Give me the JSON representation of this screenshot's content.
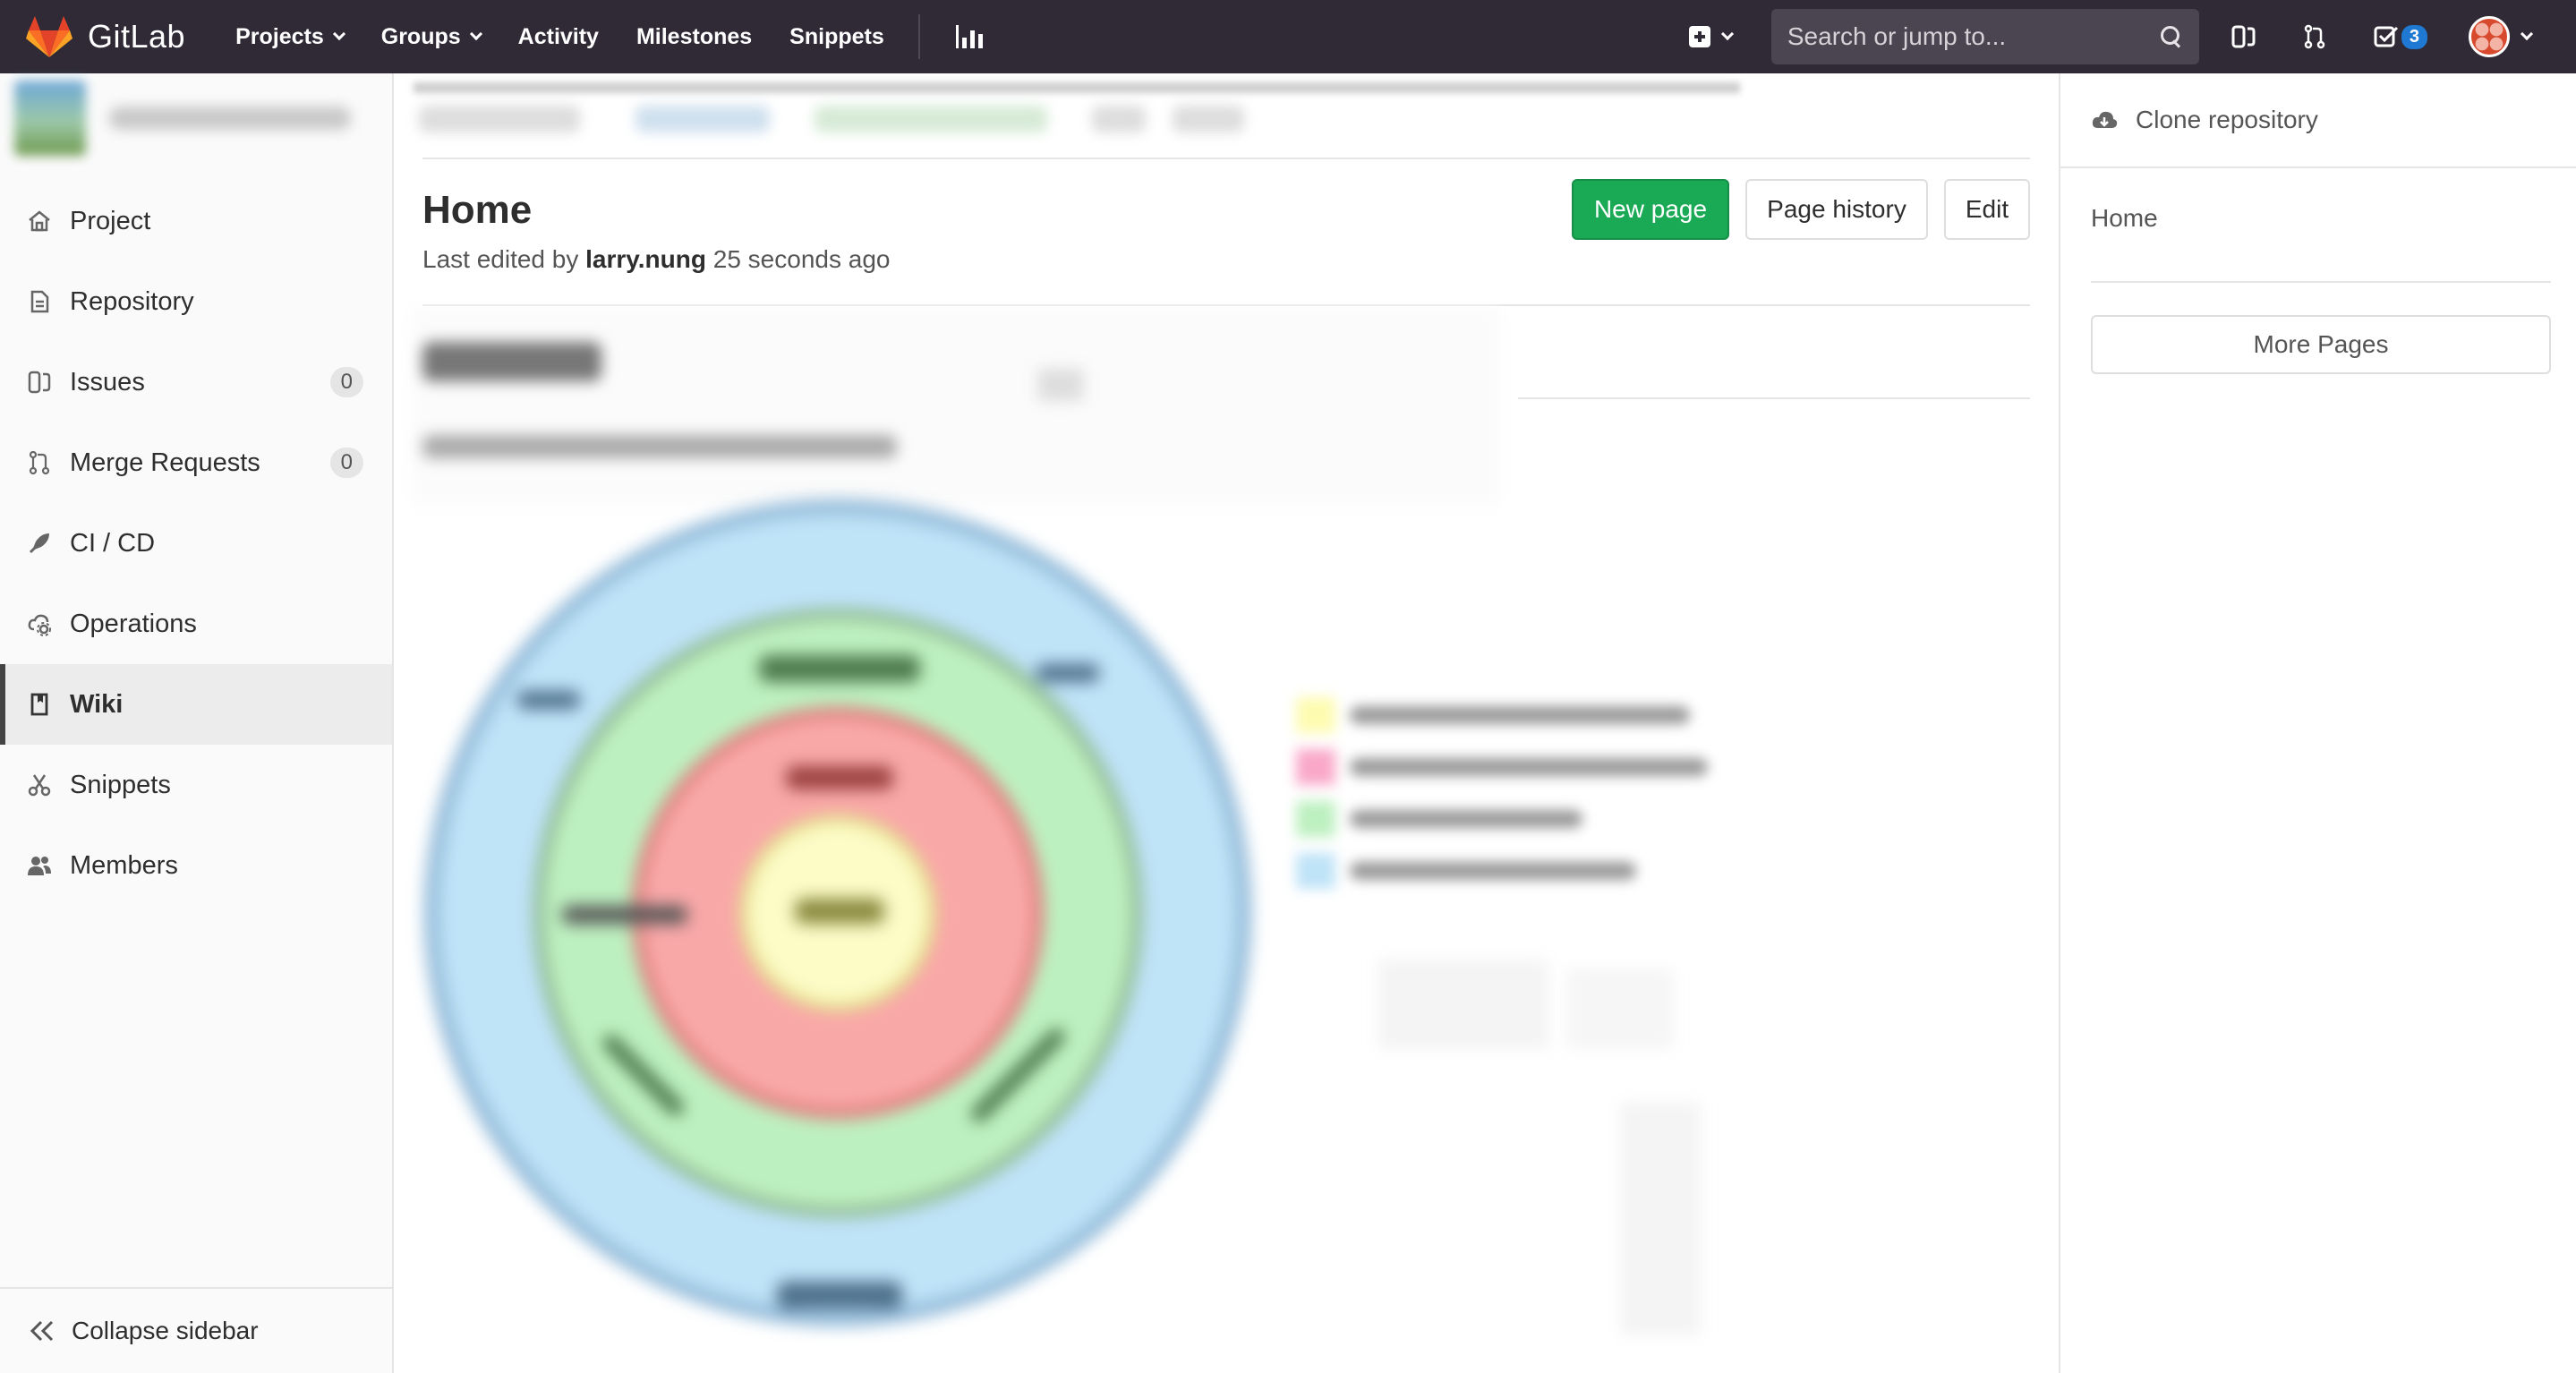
{
  "navbar": {
    "brand": "GitLab",
    "links": [
      {
        "label": "Projects",
        "dropdown": true
      },
      {
        "label": "Groups",
        "dropdown": true
      },
      {
        "label": "Activity",
        "dropdown": false
      },
      {
        "label": "Milestones",
        "dropdown": false
      },
      {
        "label": "Snippets",
        "dropdown": false
      }
    ],
    "search_placeholder": "Search or jump to...",
    "todo_count": "3",
    "colors": {
      "background": "#2f2a36",
      "badge": "#1f78d1"
    }
  },
  "sidebar": {
    "items": [
      {
        "label": "Project",
        "icon": "home-icon"
      },
      {
        "label": "Repository",
        "icon": "file-icon"
      },
      {
        "label": "Issues",
        "icon": "issues-icon",
        "count": "0"
      },
      {
        "label": "Merge Requests",
        "icon": "merge-request-icon",
        "count": "0"
      },
      {
        "label": "CI / CD",
        "icon": "rocket-icon"
      },
      {
        "label": "Operations",
        "icon": "cloud-gear-icon"
      },
      {
        "label": "Wiki",
        "icon": "book-icon",
        "active": true
      },
      {
        "label": "Snippets",
        "icon": "scissors-icon"
      },
      {
        "label": "Members",
        "icon": "users-icon"
      }
    ],
    "collapse_label": "Collapse sidebar"
  },
  "wiki": {
    "title": "Home",
    "last_edited_prefix": "Last edited by",
    "author": "larry.nung",
    "time_ago": "25 seconds ago",
    "buttons": {
      "new_page": "New page",
      "page_history": "Page history",
      "edit": "Edit"
    },
    "colors": {
      "new_page_button": "#1aaa55"
    }
  },
  "right_sidebar": {
    "clone_label": "Clone repository",
    "pages": [
      "Home"
    ],
    "more_pages_label": "More Pages"
  }
}
